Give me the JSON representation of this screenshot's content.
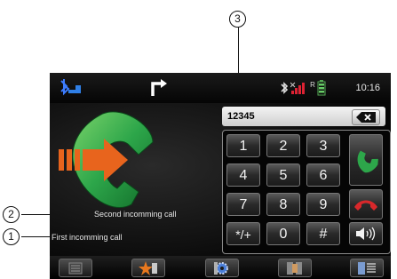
{
  "callouts": [
    {
      "number": "1"
    },
    {
      "number": "2"
    },
    {
      "number": "3"
    }
  ],
  "status": {
    "clock": "10:16",
    "signal_flag": "R"
  },
  "dial": {
    "number": "12345"
  },
  "keypad": {
    "keys": [
      "1",
      "2",
      "3",
      "4",
      "5",
      "6",
      "7",
      "8",
      "9",
      "*/+",
      "0",
      "#"
    ]
  },
  "calls": {
    "second_label": "Second incomming call",
    "first_label": "First incomming call"
  },
  "colors": {
    "accept_green": "#2da64a",
    "reject_red": "#d8282b",
    "arrow_orange": "#e8641d",
    "star_orange": "#e8781e"
  },
  "icons": {
    "status_left": "bluetooth-phone-icon",
    "status_center": "route-arrow-icon",
    "status_right": [
      "bluetooth-icon",
      "signal-strength-icon",
      "battery-icon"
    ],
    "backspace": "backspace-icon",
    "accept": "call-accept-icon",
    "reject": "call-end-icon",
    "volume": "speaker-volume-icon",
    "bottom": [
      "call-list-icon",
      "favorites-icon",
      "settings-icon",
      "contacts-icon",
      "menu-list-icon"
    ]
  }
}
